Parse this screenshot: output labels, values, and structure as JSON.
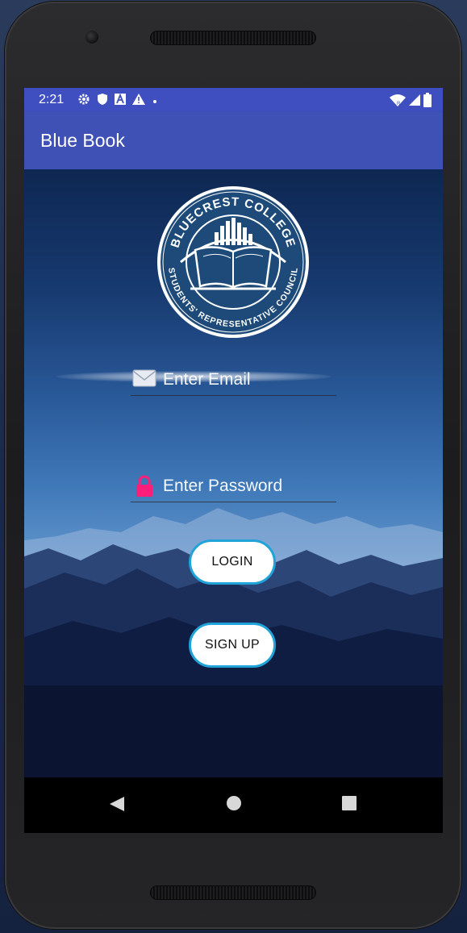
{
  "status_bar": {
    "time": "2:21",
    "left_icons": [
      "gear-icon",
      "shield-icon",
      "a-box-icon",
      "warning-icon",
      "dot-icon"
    ],
    "right_icons": [
      "wifi-icon",
      "signal-icon",
      "battery-icon"
    ]
  },
  "app_bar": {
    "title": "Blue Book"
  },
  "logo": {
    "top_text": "BLUECREST COLLEGE",
    "bottom_text": "STUDENTS' REPRESENTATIVE COUNCIL"
  },
  "form": {
    "email": {
      "placeholder": "Enter Email",
      "value": "",
      "icon": "envelope-icon"
    },
    "password": {
      "placeholder": "Enter Password",
      "value": "",
      "icon": "lock-icon"
    }
  },
  "buttons": {
    "login_label": "LOGIN",
    "signup_label": "SIGN UP"
  },
  "nav": {
    "items": [
      "back-icon",
      "home-icon",
      "recent-apps-icon"
    ]
  },
  "colors": {
    "app_bar": "#3f51b5",
    "status_bar": "#3f4fbf",
    "button_border": "#1fa3d8",
    "lock_icon": "#ff1f7a"
  }
}
